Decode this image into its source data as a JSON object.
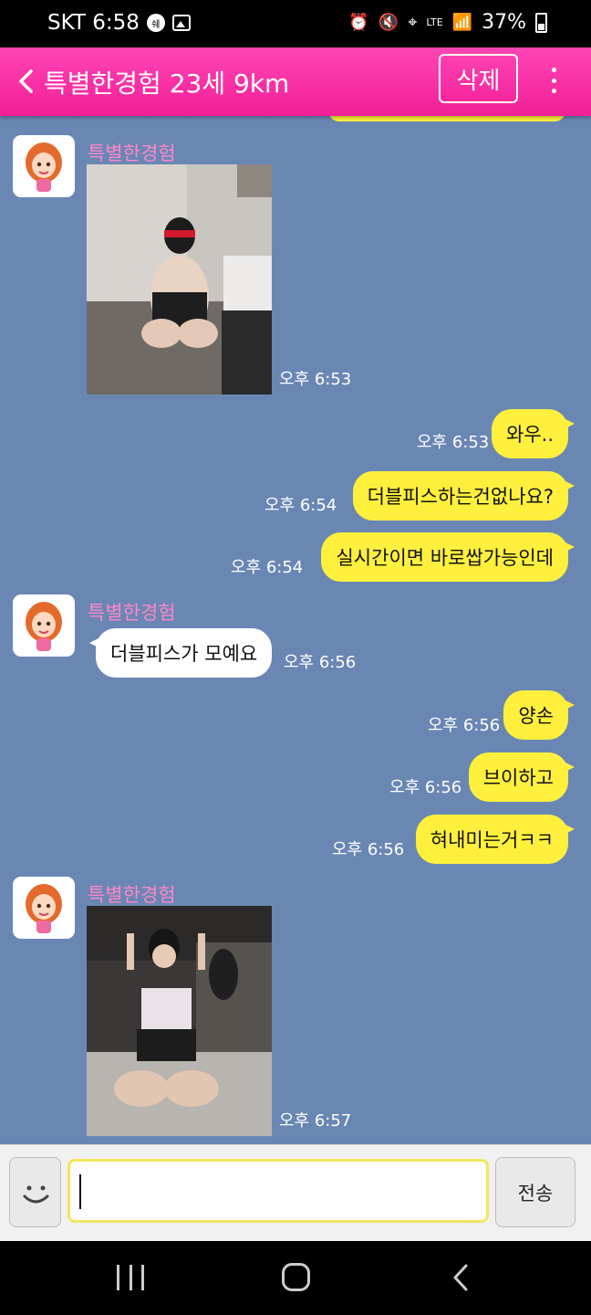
{
  "status_bar": {
    "carrier_time": "SKT 6:58",
    "badge": "쉐",
    "network": "LTE",
    "battery": "37%"
  },
  "header": {
    "title": "특별한경험 23세 9km",
    "delete_label": "삭제"
  },
  "chat": {
    "sender_name": "특별한경험",
    "messages": [
      {
        "time": "오후 6:53"
      },
      {
        "text": "와우..",
        "time": "오후 6:53"
      },
      {
        "text": "더블피스하는건없나요?",
        "time": "오후 6:54"
      },
      {
        "text": "실시간이면 바로쌉가능인데",
        "time": "오후 6:54"
      },
      {
        "text": "더블피스가 모예요",
        "time": "오후 6:56"
      },
      {
        "text": "양손",
        "time": "오후 6:56"
      },
      {
        "text": "브이하고",
        "time": "오후 6:56"
      },
      {
        "text": "혀내미는거ㅋㅋ",
        "time": "오후 6:56"
      },
      {
        "time": "오후 6:57"
      }
    ]
  },
  "input": {
    "value": "",
    "send_label": "전송"
  },
  "colors": {
    "header": "#f21f97",
    "chat_bg": "#6a87b4",
    "my_bubble": "#fef03c",
    "their_bubble": "#ffffff",
    "sender_name": "#ff86c9"
  }
}
